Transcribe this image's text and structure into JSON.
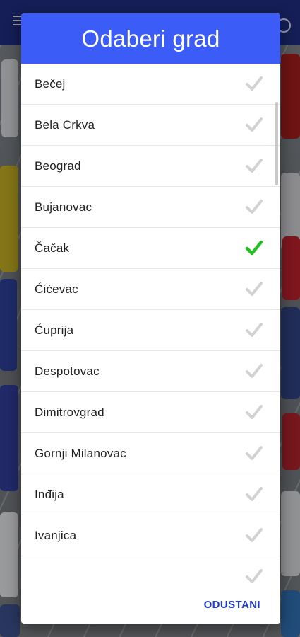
{
  "dialog": {
    "title": "Odaberi grad",
    "cancel_label": "ODUSTANI"
  },
  "colors": {
    "header": "#3b5cf6",
    "selected_check": "#1fbf1f",
    "unselected_check": "#d2d2d2",
    "cancel_text": "#1e3bd1"
  },
  "icons": {
    "checkmark": "check-icon",
    "menu": "menu-icon",
    "eye": "eye-icon"
  },
  "cities": [
    {
      "name": "Bečej",
      "selected": false
    },
    {
      "name": "Bela Crkva",
      "selected": false
    },
    {
      "name": "Beograd",
      "selected": false
    },
    {
      "name": "Bujanovac",
      "selected": false
    },
    {
      "name": "Čačak",
      "selected": true
    },
    {
      "name": "Ćićevac",
      "selected": false
    },
    {
      "name": "Ćuprija",
      "selected": false
    },
    {
      "name": "Despotovac",
      "selected": false
    },
    {
      "name": "Dimitrovgrad",
      "selected": false
    },
    {
      "name": "Gornji Milanovac",
      "selected": false
    },
    {
      "name": "Inđija",
      "selected": false
    },
    {
      "name": "Ivanjica",
      "selected": false
    },
    {
      "name": "",
      "selected": false
    }
  ]
}
